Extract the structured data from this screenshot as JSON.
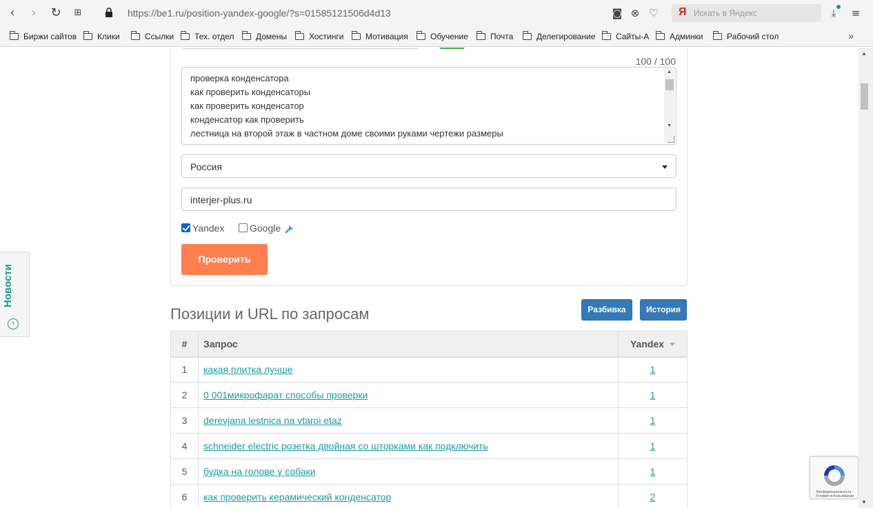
{
  "browser": {
    "url": "https://be1.ru/position-yandex-google/?s=01585121506d4d13",
    "search_logo": "Я",
    "search_placeholder": "Искать в Яндекс"
  },
  "bookmarks": [
    {
      "label": "Биржи сайтов"
    },
    {
      "label": "Клики"
    },
    {
      "label": "Ссылки"
    },
    {
      "label": "Тех. отдел"
    },
    {
      "label": "Домены"
    },
    {
      "label": "Хостинги"
    },
    {
      "label": "Мотивация"
    },
    {
      "label": "Обучение"
    },
    {
      "label": "Почта"
    },
    {
      "label": "Делегирование"
    },
    {
      "label": "Сайты-А"
    },
    {
      "label": "Админки"
    },
    {
      "label": "Рабочий стол"
    }
  ],
  "form": {
    "counter": "100 / 100",
    "keywords": [
      "проверка конденсатора",
      "как проверить конденсаторы",
      "как проверить конденсатор",
      "конденсатор как проверить",
      "лестница на второй этаж в частном доме своими руками чертежи размеры"
    ],
    "region_value": "Россия",
    "domain_value": "interjer-plus.ru",
    "yandex_label": "Yandex",
    "yandex_checked": true,
    "google_label": "Google",
    "google_checked": false,
    "submit_label": "Проверить"
  },
  "results": {
    "title": "Позиции и URL по запросам",
    "breakdown_button": "Разбивка",
    "history_button": "История",
    "columns": {
      "num": "#",
      "query": "Запрос",
      "engine": "Yandex"
    },
    "rows": [
      {
        "num": "1",
        "query": "какая плитка лучше",
        "pos": "1"
      },
      {
        "num": "2",
        "query": "0 001микрофарат способы проверки",
        "pos": "1"
      },
      {
        "num": "3",
        "query": "derevjana lestnica na vtaroi etaz",
        "pos": "1"
      },
      {
        "num": "4",
        "query": "schneider electric розетка двойная со шторками как подключить",
        "pos": "1"
      },
      {
        "num": "5",
        "query": "будка на голове у собаки",
        "pos": "1"
      },
      {
        "num": "6",
        "query": "как проверить керамический конденсатор",
        "pos": "2"
      }
    ]
  },
  "sidebar": {
    "news_label": "Новости"
  },
  "recaptcha": {
    "text": "Конфиденциальность - Условия использования"
  },
  "colors": {
    "accent_orange": "#ff7f50",
    "button_blue": "#337ab7",
    "link_teal": "#1a9ca0",
    "news_teal": "#1a9c88"
  }
}
